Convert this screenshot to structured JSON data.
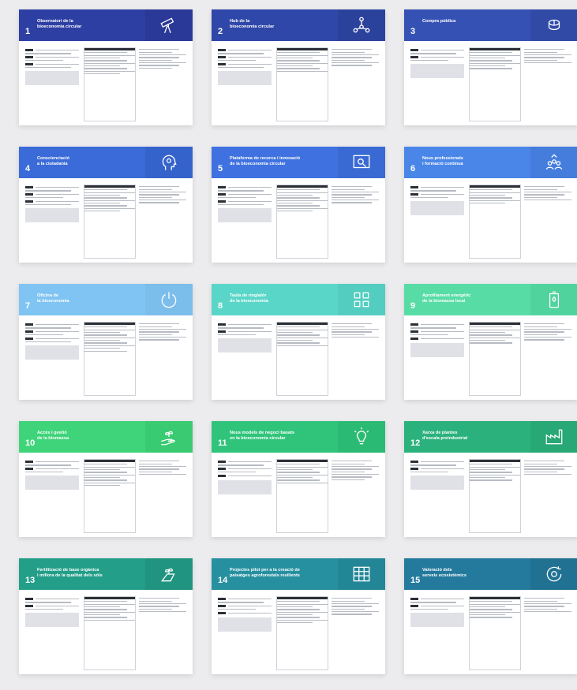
{
  "cards": [
    {
      "number": "1",
      "title": "Observatori de la\nbioeconomia circular",
      "color": "#2e3fa3",
      "icon": "telescope-icon"
    },
    {
      "number": "2",
      "title": "Hub de la\nbioeconomia circular",
      "color": "#2f47a8",
      "icon": "network-people-icon"
    },
    {
      "number": "3",
      "title": "Compra pública",
      "color": "#3551b3",
      "icon": "coins-icon"
    },
    {
      "number": "4",
      "title": "Conscienciació\na la ciutadania",
      "color": "#3a6bd8",
      "icon": "head-idea-icon"
    },
    {
      "number": "5",
      "title": "Plataforma de recerca i innovació\nde la bioeconomia circular",
      "color": "#3f72e0",
      "icon": "search-screen-icon"
    },
    {
      "number": "6",
      "title": "Nous professionals\ni formació contínua",
      "color": "#4a86e8",
      "icon": "people-growth-icon"
    },
    {
      "number": "7",
      "title": "Oficina de\nla bioeconomia",
      "color": "#7fc4f2",
      "icon": "power-icon"
    },
    {
      "number": "8",
      "title": "Taula de ringlatòr\nde la bioeconomia",
      "color": "#5ad6c8",
      "icon": "city-grid-icon"
    },
    {
      "number": "9",
      "title": "Aprofitament energètic\nde la biomassa local",
      "color": "#58dca6",
      "icon": "battery-leaf-icon"
    },
    {
      "number": "10",
      "title": "Accés i gestió\nde la biomassa",
      "color": "#3fd47a",
      "icon": "hand-plant-icon"
    },
    {
      "number": "11",
      "title": "Nous models de negoci basats\nen la bioeconomia circular",
      "color": "#30c47a",
      "icon": "lightbulb-icon"
    },
    {
      "number": "12",
      "title": "Xarxa de plantes\nd'escala preindustrial",
      "color": "#2bb27c",
      "icon": "factory-icon"
    },
    {
      "number": "13",
      "title": "Fertilització de base orgànica\ni millora de la qualitat dels sòls",
      "color": "#239e88",
      "icon": "soil-sprout-icon"
    },
    {
      "number": "14",
      "title": "Projectes pilot per a la creació de\npaisatges agroforestals resilients",
      "color": "#2690a0",
      "icon": "forest-grid-icon"
    },
    {
      "number": "15",
      "title": "Valoració dels\nserveis ecosistèmics",
      "color": "#237a9c",
      "icon": "cycle-arrows-icon"
    }
  ]
}
